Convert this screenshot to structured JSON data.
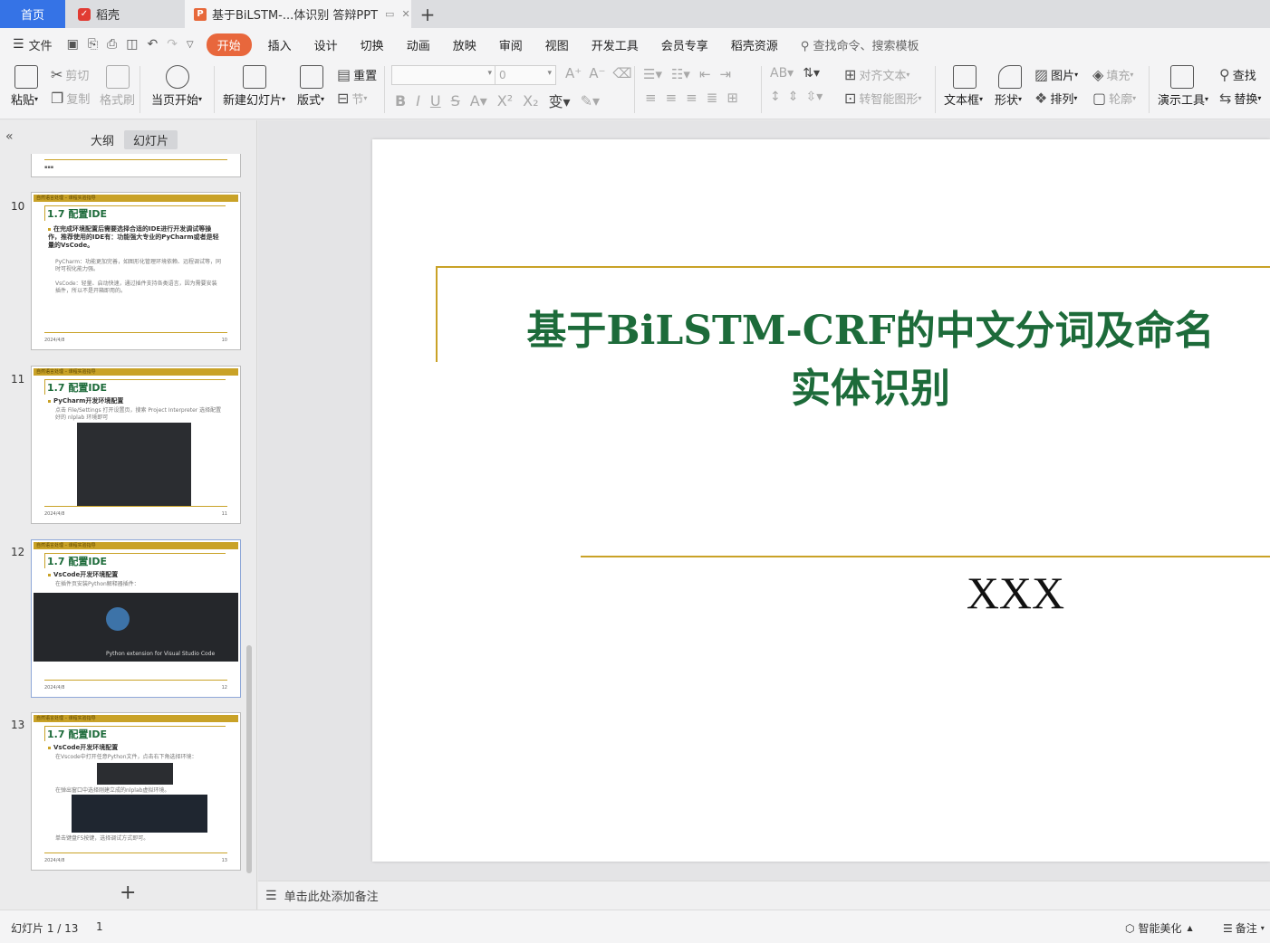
{
  "tabs": {
    "home": "首页",
    "daoke": "稻壳",
    "doc": "基于BiLSTM-...体识别 答辩PPT"
  },
  "menu": {
    "file": "文件",
    "items": [
      "开始",
      "插入",
      "设计",
      "切换",
      "动画",
      "放映",
      "审阅",
      "视图",
      "开发工具",
      "会员专享",
      "稻壳资源"
    ],
    "search": "查找命令、搜索模板"
  },
  "ribbon": {
    "paste": "粘贴",
    "cut": "剪切",
    "copy": "复制",
    "format_painter": "格式刷",
    "from_current": "当页开始",
    "new_slide": "新建幻灯片",
    "layout": "版式",
    "reset": "重置",
    "section": "节",
    "font_size": "0",
    "align_text": "对齐文本",
    "smart_shape": "转智能图形",
    "textbox": "文本框",
    "shape": "形状",
    "picture": "图片",
    "arrange": "排列",
    "fill": "填充",
    "outline": "轮廓",
    "present_tools": "演示工具",
    "find": "查找",
    "replace": "替换"
  },
  "panel": {
    "outline_tab": "大纲",
    "slides_tab": "幻灯片"
  },
  "thumbs": [
    {
      "num": "10",
      "band": "自然语言处理 – 课程实验指导",
      "title": "1.7 配置IDE",
      "text": "在完成环境配置后需要选择合适的IDE进行开发调试等操作，推荐使用的IDE有：功能强大专业的PyCharm或者是轻量的VsCode。",
      "sub1": "PyCharm：功能更加完善，如图形化管理环境依赖、远程调试等，同时可视化能力强。",
      "sub2": "VsCode：轻量、启动快速，通过插件支持各类语言，因为需要安装插件，所以不是开箱即用的。",
      "foot": "2024/4/8",
      "page": "10"
    },
    {
      "num": "11",
      "band": "自然语言处理 – 课程实验指导",
      "title": "1.7 配置IDE",
      "text": "PyCharm开发环境配置",
      "sub1": "点击 File/Settings 打开设置页，搜索 Project Interpreter 选择配置好的 nlplab 环境即可",
      "foot": "2024/4/8",
      "page": "11"
    },
    {
      "num": "12",
      "band": "自然语言处理 – 课程实验指导",
      "title": "1.7 配置IDE",
      "text": "VsCode开发环境配置",
      "sub1": "在插件页安装Python解释器插件：",
      "ext_name": "Python extension for Visual Studio Code",
      "foot": "2024/4/8",
      "page": "12"
    },
    {
      "num": "13",
      "band": "自然语言处理 – 课程实验指导",
      "title": "1.7 配置IDE",
      "text": "VsCode开发环境配置",
      "sub1": "在Vscode中打开任意Python文件，点击右下角选择环境：",
      "sub2": "在弹出窗口中选择刚建立成的nlplab虚拟环境。",
      "sub3": "单击键盘F5按键，选择调试方式即可。",
      "foot": "2024/4/8",
      "page": "13"
    }
  ],
  "slide": {
    "title_line1": "基于BiLSTM-CRF的中文分词及命名",
    "title_line2": "实体识别",
    "author": "XXX"
  },
  "notes": "单击此处添加备注",
  "status": {
    "slide_counter": "幻灯片 1 / 13",
    "section": "1",
    "beautify": "智能美化",
    "notes": "备注"
  },
  "colors": {
    "accent_tab": "#3573e6",
    "start_pill": "#e8673c",
    "gold": "#c9a227",
    "title_green": "#1d6b3a"
  }
}
